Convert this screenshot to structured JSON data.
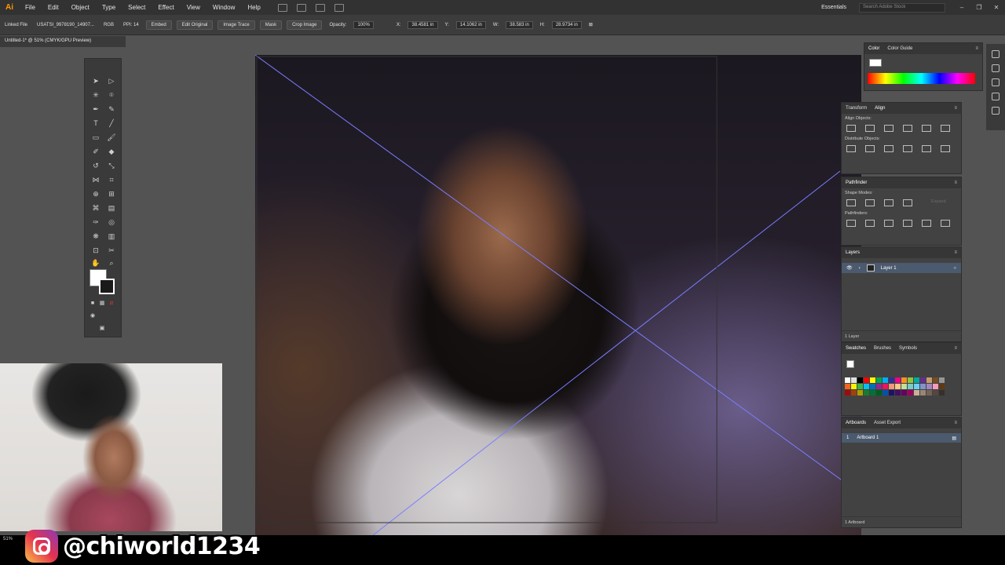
{
  "app": {
    "logo": "Ai"
  },
  "menubar": {
    "items": [
      "File",
      "Edit",
      "Object",
      "Type",
      "Select",
      "Effect",
      "View",
      "Window",
      "Help"
    ],
    "workspace": "Essentials",
    "search_placeholder": "Search Adobe Stock"
  },
  "controlbar": {
    "linked_file": "Linked File",
    "file_name": "USATSI_9978190_14907...",
    "color_mode": "RGB",
    "ppi": "PPI: 14",
    "embed": "Embed",
    "edit_original": "Edit Original",
    "image_trace": "Image Trace",
    "mask": "Mask",
    "crop_image": "Crop Image",
    "opacity_label": "Opacity:",
    "opacity_value": "100%",
    "x_label": "X:",
    "x_value": "38.4581 in",
    "y_label": "Y:",
    "y_value": "14.1062 in",
    "w_label": "W:",
    "w_value": "38.583 in",
    "h_label": "H:",
    "h_value": "28.9734 in"
  },
  "document": {
    "tab": "Untitled-1* @ 51% (CMYK/GPU Preview)",
    "zoom": "51%"
  },
  "panels": {
    "color": {
      "tabs": [
        "Color",
        "Color Guide"
      ]
    },
    "align": {
      "tabs": [
        "Transform",
        "Align"
      ],
      "align_objects": "Align Objects:",
      "distribute_objects": "Distribute Objects:"
    },
    "pathfinder": {
      "title": "Pathfinder",
      "shape_modes": "Shape Modes:",
      "pathfinders": "Pathfinders:",
      "expand": "Expand"
    },
    "layers": {
      "title": "Layers",
      "layer_name": "Layer 1",
      "footer": "1 Layer"
    },
    "swatches": {
      "tabs": [
        "Swatches",
        "Brushes",
        "Symbols"
      ]
    },
    "artboards": {
      "tabs": [
        "Artboards",
        "Asset Export"
      ],
      "row_index": "1",
      "row_name": "Artboard 1",
      "footer": "1 Artboard"
    }
  },
  "swatch_colors": [
    "#ffffff",
    "#e0e0e0",
    "#000000",
    "#ff0000",
    "#ffff00",
    "#00a651",
    "#00aeef",
    "#2e3192",
    "#ec008c",
    "#f7941d",
    "#8dc63f",
    "#00a99d",
    "#662d91",
    "#c69c6d",
    "#754c24",
    "#959595",
    "#f26522",
    "#fff200",
    "#39b54a",
    "#00bff3",
    "#0072bc",
    "#92278f",
    "#ed145b",
    "#f69679",
    "#fdc689",
    "#c4df9b",
    "#7accc8",
    "#6dcff6",
    "#8393ca",
    "#a187be",
    "#f49ac1",
    "#603913",
    "#9e0b0f",
    "#a0410d",
    "#aba000",
    "#197b30",
    "#007236",
    "#005e20",
    "#0054a6",
    "#1b1464",
    "#440e62",
    "#630460",
    "#9e005d",
    "#c7b299",
    "#998675",
    "#736357",
    "#534741",
    "#362f2d"
  ],
  "overlay": {
    "handle": "@chiworld1234"
  }
}
